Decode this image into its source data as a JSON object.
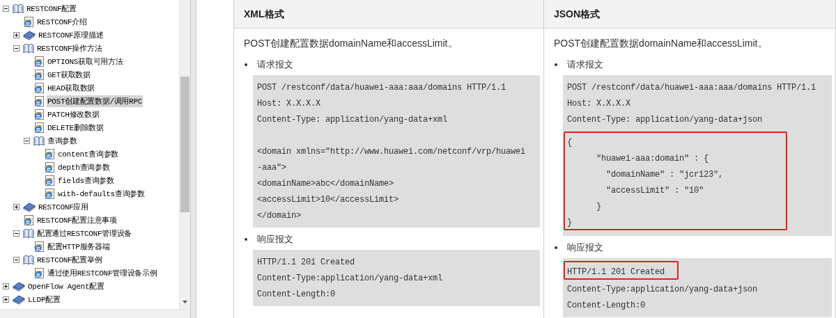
{
  "tree": [
    {
      "label": "RESTCONF配置",
      "kind": "book",
      "expanded": true,
      "selected": false,
      "children": [
        {
          "label": "RESTCONF介绍",
          "kind": "page",
          "selected": false
        },
        {
          "label": "RESTCONF原理描述",
          "kind": "book",
          "expanded": false,
          "selected": false
        },
        {
          "label": "RESTCONF操作方法",
          "kind": "book",
          "expanded": true,
          "selected": false,
          "children": [
            {
              "label": "OPTIONS获取可用方法",
              "kind": "page",
              "selected": false
            },
            {
              "label": "GET获取数据",
              "kind": "page",
              "selected": false
            },
            {
              "label": "HEAD获取数据",
              "kind": "page",
              "selected": false
            },
            {
              "label": "POST创建配置数据/调用RPC",
              "kind": "page",
              "selected": true
            },
            {
              "label": "PATCH修改数据",
              "kind": "page",
              "selected": false
            },
            {
              "label": "DELETE删除数据",
              "kind": "page",
              "selected": false
            },
            {
              "label": "查询参数",
              "kind": "book",
              "expanded": true,
              "selected": false,
              "children": [
                {
                  "label": "content查询参数",
                  "kind": "page",
                  "selected": false
                },
                {
                  "label": "depth查询参数",
                  "kind": "page",
                  "selected": false
                },
                {
                  "label": "fields查询参数",
                  "kind": "page",
                  "selected": false
                },
                {
                  "label": "with-defaults查询参数",
                  "kind": "page",
                  "selected": false
                }
              ]
            }
          ]
        },
        {
          "label": "RESTCONF应用",
          "kind": "book",
          "expanded": false,
          "selected": false
        },
        {
          "label": "RESTCONF配置注意事项",
          "kind": "page",
          "selected": false
        },
        {
          "label": "配置通过RESTCONF管理设备",
          "kind": "book",
          "expanded": true,
          "selected": false,
          "children": [
            {
              "label": "配置HTTP服务器端",
              "kind": "page",
              "selected": false
            }
          ]
        },
        {
          "label": "RESTCONF配置举例",
          "kind": "book",
          "expanded": true,
          "selected": false,
          "children": [
            {
              "label": "通过使用RESTCONF管理设备示例",
              "kind": "page",
              "selected": false
            }
          ]
        }
      ]
    },
    {
      "label": "OpenFlow  Agent配置",
      "kind": "book",
      "expanded": false,
      "selected": false
    },
    {
      "label": "LLDP配置",
      "kind": "book",
      "expanded": false,
      "selected": false
    }
  ],
  "table": {
    "columns": [
      {
        "heading": "XML格式",
        "intro": "POST创建配置数据domainName和accessLimit。",
        "sections": [
          {
            "label": "请求报文",
            "segments": [
              {
                "highlighted": false,
                "lines": [
                  "POST /restconf/data/huawei-aaa:aaa/domains HTTP/1.1",
                  "Host: X.X.X.X",
                  "Content-Type: application/yang-data+xml"
                ]
              },
              {
                "highlighted": false,
                "spaced": true,
                "lines": [
                  "<domain xmlns=\"http://www.huawei.com/netconf/vrp/huawei",
                  "-aaa\">",
                  "<domainName>abc</domainName>",
                  "<accessLimit>10</accessLimit>",
                  "</domain>"
                ]
              }
            ]
          },
          {
            "label": "响应报文",
            "segments": [
              {
                "highlighted": false,
                "lines": [
                  "HTTP/1.1 201 Created",
                  "Content-Type:application/yang-data+xml",
                  "Content-Length:0"
                ]
              }
            ]
          }
        ]
      },
      {
        "heading": "JSON格式",
        "intro": "POST创建配置数据domainName和accessLimit。",
        "sections": [
          {
            "label": "请求报文",
            "segments": [
              {
                "highlighted": false,
                "lines": [
                  "POST /restconf/data/huawei-aaa:aaa/domains HTTP/1.1",
                  "Host: X.X.X.X",
                  "Content-Type: application/yang-data+json"
                ]
              },
              {
                "highlighted": true,
                "lines": [
                  "{",
                  "      \"huawei-aaa:domain\" : {",
                  "        \"domainName\" : \"jcr123\",",
                  "        \"accessLimit\" : \"10\"",
                  "      }",
                  "}"
                ]
              }
            ]
          },
          {
            "label": "响应报文",
            "segments": [
              {
                "highlighted": true,
                "lines": [
                  "HTTP/1.1 201 Created"
                ]
              },
              {
                "highlighted": false,
                "lines": [
                  "Content-Type:application/yang-data+json",
                  "Content-Length:0"
                ]
              }
            ]
          }
        ]
      }
    ]
  }
}
